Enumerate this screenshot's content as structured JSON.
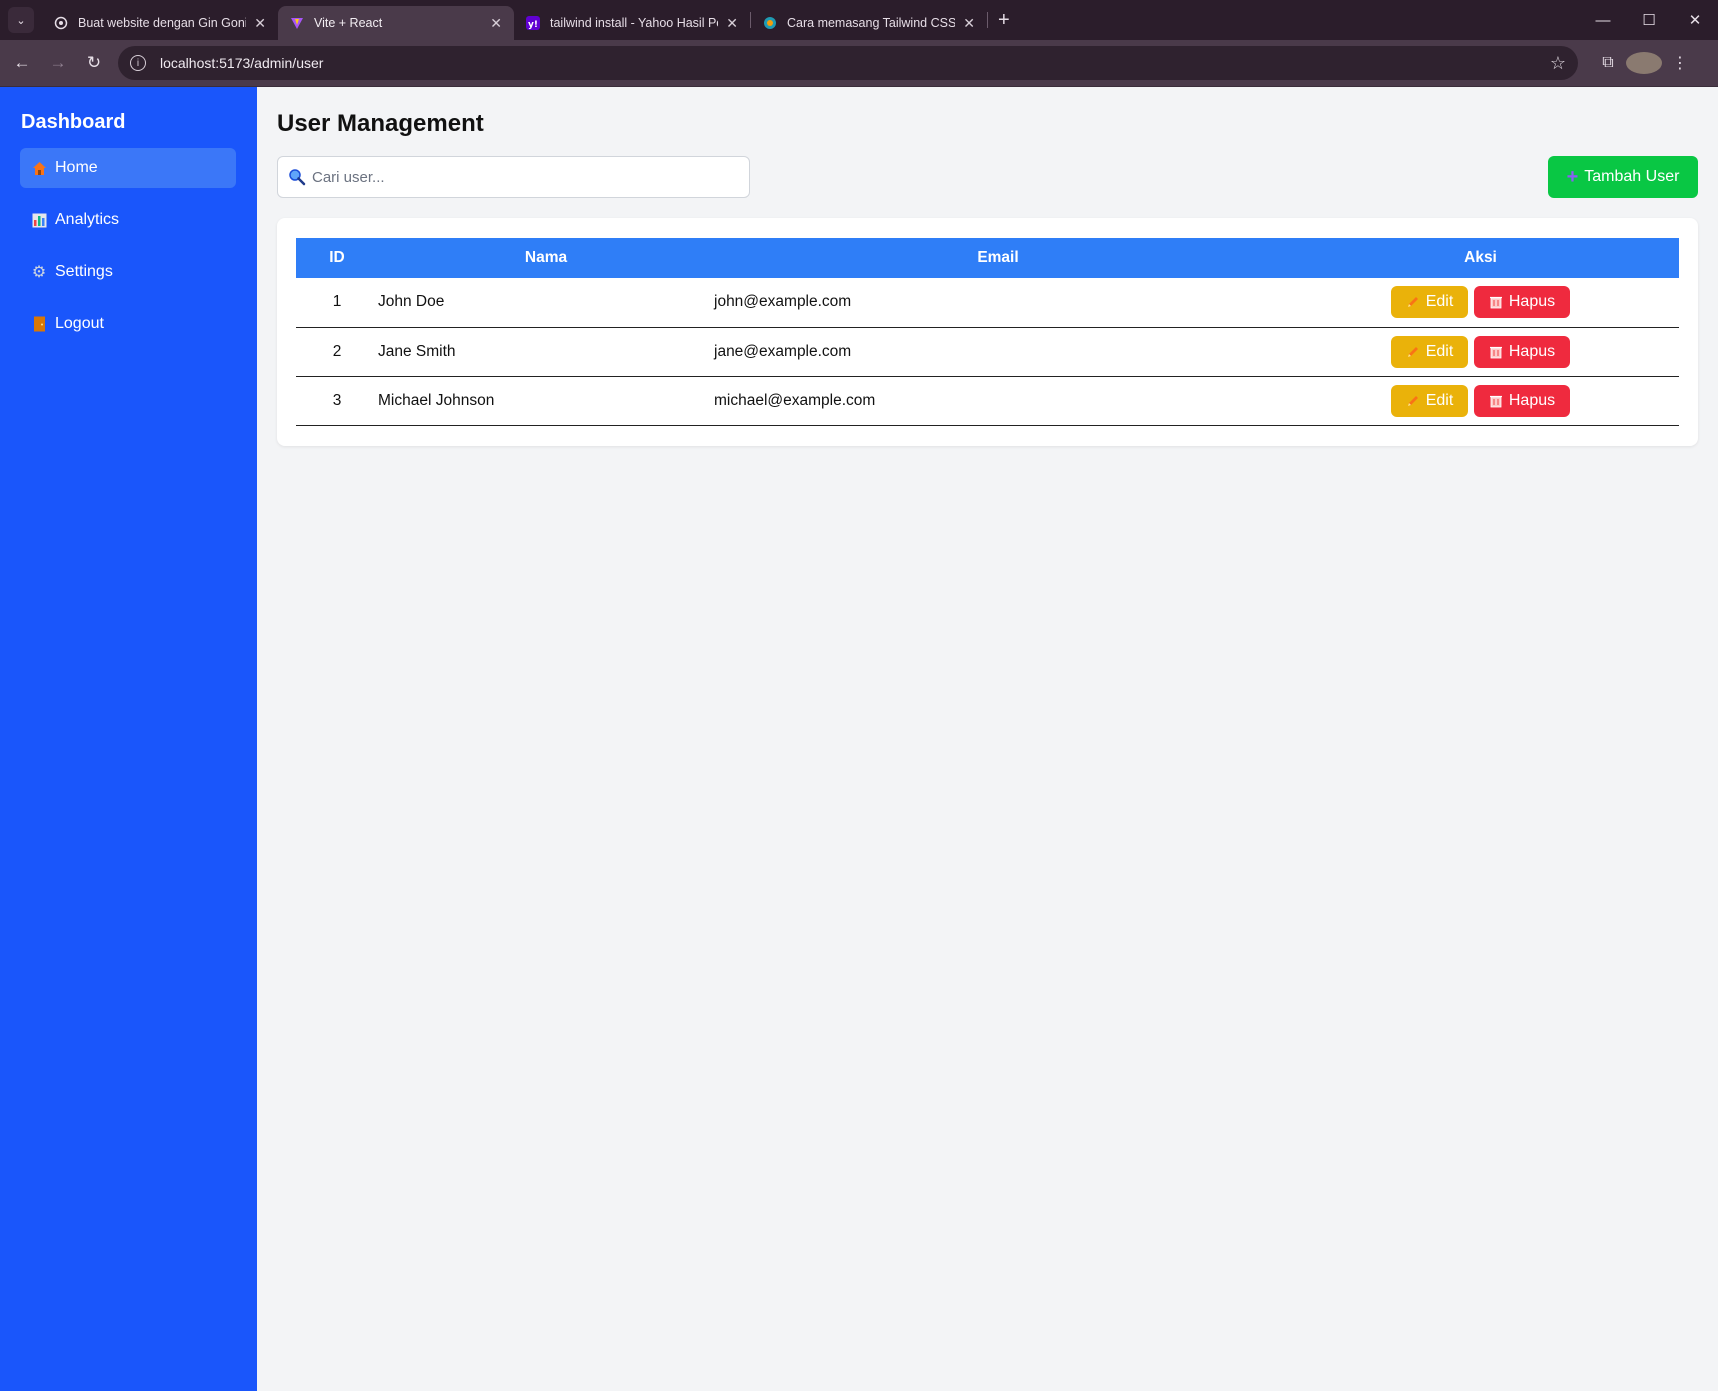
{
  "browser": {
    "tabs": [
      {
        "title": "Buat website dengan Gin Gonic",
        "active": false,
        "icon": "chatgpt-icon"
      },
      {
        "title": "Vite + React",
        "active": true,
        "icon": "vite-icon"
      },
      {
        "title": "tailwind install - Yahoo Hasil Pe",
        "active": false,
        "icon": "yahoo-icon"
      },
      {
        "title": "Cara memasang Tailwind CSS w",
        "active": false,
        "icon": "copilot-icon"
      }
    ],
    "url": "localhost:5173/admin/user"
  },
  "sidebar": {
    "title": "Dashboard",
    "items": [
      {
        "label": "Home",
        "icon": "home-icon",
        "active": true
      },
      {
        "label": "Analytics",
        "icon": "chart-icon",
        "active": false
      },
      {
        "label": "Settings",
        "icon": "gear-icon",
        "active": false
      },
      {
        "label": "Logout",
        "icon": "door-icon",
        "active": false
      }
    ]
  },
  "main": {
    "title": "User Management",
    "search_placeholder": "Cari user...",
    "add_button": "Tambah User",
    "table": {
      "headers": [
        "ID",
        "Nama",
        "Email",
        "Aksi"
      ],
      "rows": [
        {
          "id": "1",
          "name": "John Doe",
          "email": "john@example.com"
        },
        {
          "id": "2",
          "name": "Jane Smith",
          "email": "jane@example.com"
        },
        {
          "id": "3",
          "name": "Michael Johnson",
          "email": "michael@example.com"
        }
      ],
      "edit_label": "Edit",
      "delete_label": "Hapus"
    }
  },
  "colors": {
    "sidebar": "#1a56fb",
    "header": "#2f7ef7",
    "add": "#09c744",
    "edit": "#eab20a",
    "delete": "#ef2a3e"
  }
}
